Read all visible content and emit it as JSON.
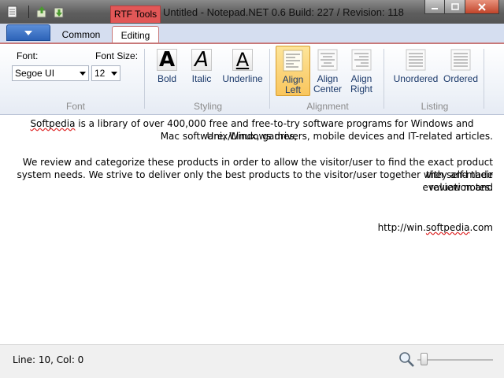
{
  "window": {
    "title": "Untitled - Notepad.NET 0.6 Build: 227 / Revision: 118",
    "contextual_tab": "RTF Tools"
  },
  "ribbon": {
    "tabs": [
      "Common",
      "Editing"
    ],
    "active_tab": "Editing",
    "font_group": {
      "font_label": "Font:",
      "size_label": "Font Size:",
      "font_value": "Segoe UI",
      "size_value": "12",
      "name": "Font"
    },
    "styling_group": {
      "name": "Styling",
      "bold_label": "Bold",
      "italic_label": "Italic",
      "underline_label": "Underline"
    },
    "alignment_group": {
      "name": "Alignment",
      "left_line1": "Align",
      "left_line2": "Left",
      "center_line1": "Align",
      "center_line2": "Center",
      "right_line1": "Align",
      "right_line2": "Right",
      "active": "Align Left"
    },
    "listing_group": {
      "name": "Listing",
      "unordered_label": "Unordered",
      "ordered_label": "Ordered"
    }
  },
  "document": {
    "p1_word": "Softpedia",
    "p1_rest": " is a library of over 400,000 free and free-to-try software programs for Windows and Unix/Linux, games,",
    "p1_line2": "Mac software, Windows drivers, mobile devices and IT-related articles.",
    "p2_line1": "We review and categorize these products in order to allow the visitor/user to find the exact product they and their",
    "p2_line2": "system needs. We strive to deliver only the best products to the visitor/user together with self-made evaluation and",
    "p2_line3": "review notes.",
    "link_prefix": "http://win.",
    "link_word": "softpedia",
    "link_suffix": ".com"
  },
  "status": {
    "position": "Line: 10, Col: 0",
    "zoom_level": 0.05
  },
  "colors": {
    "contextual_tab": "#e25757",
    "active_button": "#f9c55d",
    "ribbon_accent": "#c87878"
  }
}
